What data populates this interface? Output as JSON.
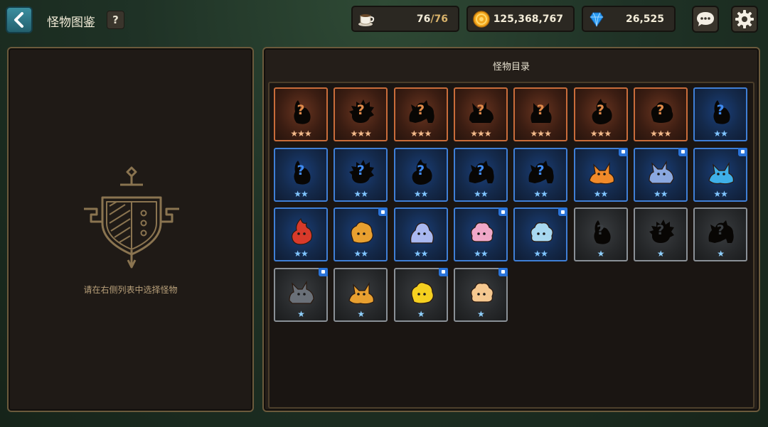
{
  "header": {
    "title": "怪物图鉴",
    "help_label": "?",
    "stamina": {
      "current": "76",
      "separator": "/",
      "max": "76"
    },
    "gold": "125,368,767",
    "gems": "26,525"
  },
  "left_panel": {
    "hint": "请在右侧列表中选择怪物"
  },
  "catalog": {
    "title": "怪物目录",
    "monsters": [
      {
        "rarity": 3,
        "stars": "★★★",
        "unknown": true,
        "badge": false,
        "shape": "rabbit"
      },
      {
        "rarity": 3,
        "stars": "★★★",
        "unknown": true,
        "badge": false,
        "shape": "spiky"
      },
      {
        "rarity": 3,
        "stars": "★★★",
        "unknown": true,
        "badge": false,
        "shape": "beast"
      },
      {
        "rarity": 3,
        "stars": "★★★",
        "unknown": true,
        "badge": false,
        "shape": "wolf"
      },
      {
        "rarity": 3,
        "stars": "★★★",
        "unknown": true,
        "badge": false,
        "shape": "cat"
      },
      {
        "rarity": 3,
        "stars": "★★★",
        "unknown": true,
        "badge": false,
        "shape": "flame"
      },
      {
        "rarity": 3,
        "stars": "★★★",
        "unknown": true,
        "badge": false,
        "shape": "blob"
      },
      {
        "rarity": 2,
        "stars": "★★",
        "unknown": true,
        "badge": false,
        "shape": "rabbit"
      },
      {
        "rarity": 2,
        "stars": "★★",
        "unknown": true,
        "badge": false,
        "shape": "rabbit"
      },
      {
        "rarity": 2,
        "stars": "★★",
        "unknown": true,
        "badge": false,
        "shape": "spiky"
      },
      {
        "rarity": 2,
        "stars": "★★",
        "unknown": true,
        "badge": false,
        "shape": "flame"
      },
      {
        "rarity": 2,
        "stars": "★★",
        "unknown": true,
        "badge": false,
        "shape": "beast"
      },
      {
        "rarity": 2,
        "stars": "★★",
        "unknown": true,
        "badge": false,
        "shape": "beast"
      },
      {
        "rarity": 2,
        "stars": "★★",
        "unknown": false,
        "badge": true,
        "shape": "fox",
        "color": "#f08a2a"
      },
      {
        "rarity": 2,
        "stars": "★★",
        "unknown": false,
        "badge": true,
        "shape": "wolf",
        "color": "#8aa8e0"
      },
      {
        "rarity": 2,
        "stars": "★★",
        "unknown": false,
        "badge": true,
        "shape": "fox",
        "color": "#3fb0e8"
      },
      {
        "rarity": 2,
        "stars": "★★",
        "unknown": false,
        "badge": false,
        "shape": "flame",
        "color": "#d83a2a"
      },
      {
        "rarity": 2,
        "stars": "★★",
        "unknown": false,
        "badge": true,
        "shape": "blob",
        "color": "#e8a030"
      },
      {
        "rarity": 2,
        "stars": "★★",
        "unknown": false,
        "badge": false,
        "shape": "slime",
        "color": "#a9b8f0"
      },
      {
        "rarity": 2,
        "stars": "★★",
        "unknown": false,
        "badge": true,
        "shape": "sheep",
        "color": "#f0a8c8"
      },
      {
        "rarity": 2,
        "stars": "★★",
        "unknown": false,
        "badge": true,
        "shape": "sheep",
        "color": "#a8d8f0"
      },
      {
        "rarity": 1,
        "stars": "★",
        "unknown": true,
        "badge": false,
        "shape": "rabbit"
      },
      {
        "rarity": 1,
        "stars": "★",
        "unknown": true,
        "badge": false,
        "shape": "spiky"
      },
      {
        "rarity": 1,
        "stars": "★",
        "unknown": true,
        "badge": false,
        "shape": "beast"
      },
      {
        "rarity": 1,
        "stars": "★",
        "unknown": false,
        "badge": true,
        "shape": "wolf",
        "color": "#6a7078"
      },
      {
        "rarity": 1,
        "stars": "★",
        "unknown": false,
        "badge": false,
        "shape": "fox",
        "color": "#e8a030"
      },
      {
        "rarity": 1,
        "stars": "★",
        "unknown": false,
        "badge": true,
        "shape": "blob",
        "color": "#f5d020"
      },
      {
        "rarity": 1,
        "stars": "★",
        "unknown": false,
        "badge": true,
        "shape": "sheep",
        "color": "#f5c890"
      }
    ]
  },
  "colors": {
    "rarity3_border": "#c96c3a",
    "rarity2_border": "#3f7fd6",
    "rarity1_border": "#8a9096",
    "panel_border": "#6b5a3c",
    "accent_gold": "#d9b36b"
  },
  "icons": {
    "back": "chevron-left-icon",
    "stamina": "coffee-cup-icon",
    "gold": "gold-coin-icon",
    "gems": "blue-diamond-icon",
    "chat": "chat-bubble-icon",
    "settings": "gear-icon"
  }
}
